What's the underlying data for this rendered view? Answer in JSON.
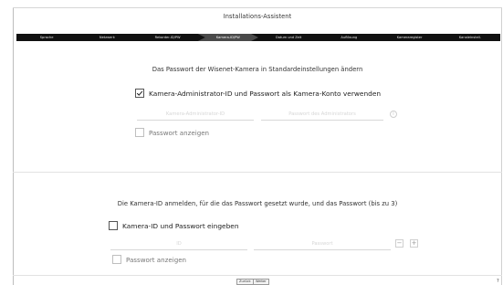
{
  "window": {
    "title": "Installations-Assistent"
  },
  "steps": [
    {
      "label": "Sprache",
      "active": false
    },
    {
      "label": "Netzwerk",
      "active": false
    },
    {
      "label": "Rekorder-ID/PW",
      "active": false
    },
    {
      "label": "Kamera-ID/PW",
      "active": true
    },
    {
      "label": "Datum und Zeit",
      "active": false
    },
    {
      "label": "Auflösung",
      "active": false
    },
    {
      "label": "Kameraregister",
      "active": false
    },
    {
      "label": "Kanaleinstell.",
      "active": false
    }
  ],
  "section1": {
    "heading": "Das Passwort der Wisenet-Kamera in Standardeinstellungen ändern",
    "use_admin_checkbox": {
      "label": "Kamera-Administrator-ID und Passwort als Kamera-Konto verwenden",
      "checked": true
    },
    "id_input": {
      "placeholder": "Kamera-Administrator-ID"
    },
    "password_input": {
      "placeholder": "Passwort des Administrators"
    },
    "info_icon": "i",
    "show_password": {
      "label": "Passwort anzeigen",
      "checked": false
    }
  },
  "section2": {
    "heading": "Die Kamera-ID anmelden, für die das Passwort gesetzt wurde, und das Passwort (bis zu 3)",
    "enter_checkbox": {
      "label": "Kamera-ID und Passwort eingeben",
      "checked": false
    },
    "id_input": {
      "placeholder": "ID"
    },
    "password_input": {
      "placeholder": "Passwort"
    },
    "minus_label": "−",
    "plus_label": "+",
    "show_password": {
      "label": "Passwort anzeigen",
      "checked": false
    }
  },
  "footer": {
    "back_label": "Zurück",
    "next_label": "Weiter",
    "corner_label": "?"
  },
  "colors": {
    "stepbar_bg": "#111111",
    "active_step": "#4a4a4a"
  }
}
